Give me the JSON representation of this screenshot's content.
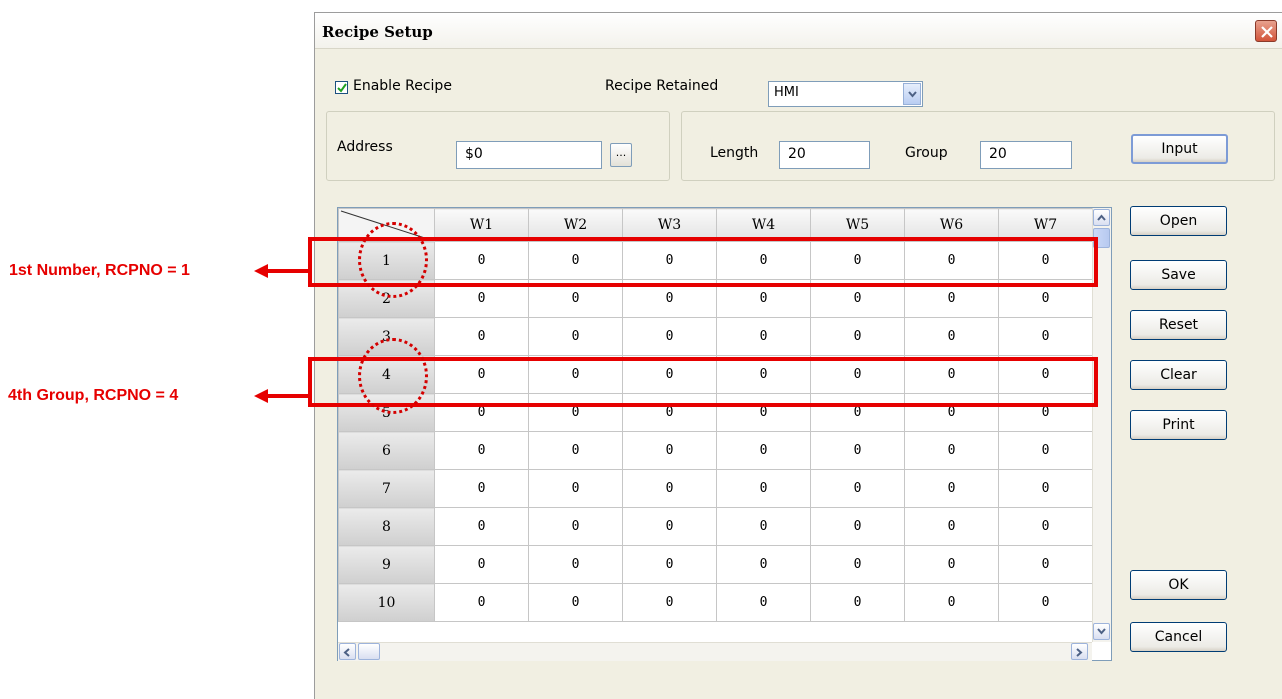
{
  "dialog": {
    "title": "Recipe Setup",
    "enable_recipe_label": "Enable Recipe",
    "enable_recipe_checked": true,
    "recipe_retained_label": "Recipe Retained",
    "recipe_retained_value": "HMI",
    "address_label": "Address",
    "address_value": "$0",
    "browse_label": "...",
    "length_label": "Length",
    "length_value": "20",
    "group_label": "Group",
    "group_value": "20",
    "input_button": "Input"
  },
  "side_buttons": [
    "Open",
    "Save",
    "Reset",
    "Clear",
    "Print"
  ],
  "ok_button": "OK",
  "cancel_button": "Cancel",
  "grid": {
    "columns": [
      "W1",
      "W2",
      "W3",
      "W4",
      "W5",
      "W6",
      "W7"
    ],
    "rows": [
      {
        "label": "1",
        "cells": [
          "0",
          "0",
          "0",
          "0",
          "0",
          "0",
          "0"
        ]
      },
      {
        "label": "2",
        "cells": [
          "0",
          "0",
          "0",
          "0",
          "0",
          "0",
          "0"
        ]
      },
      {
        "label": "3",
        "cells": [
          "0",
          "0",
          "0",
          "0",
          "0",
          "0",
          "0"
        ]
      },
      {
        "label": "4",
        "cells": [
          "0",
          "0",
          "0",
          "0",
          "0",
          "0",
          "0"
        ]
      },
      {
        "label": "5",
        "cells": [
          "0",
          "0",
          "0",
          "0",
          "0",
          "0",
          "0"
        ]
      },
      {
        "label": "6",
        "cells": [
          "0",
          "0",
          "0",
          "0",
          "0",
          "0",
          "0"
        ]
      },
      {
        "label": "7",
        "cells": [
          "0",
          "0",
          "0",
          "0",
          "0",
          "0",
          "0"
        ]
      },
      {
        "label": "8",
        "cells": [
          "0",
          "0",
          "0",
          "0",
          "0",
          "0",
          "0"
        ]
      },
      {
        "label": "9",
        "cells": [
          "0",
          "0",
          "0",
          "0",
          "0",
          "0",
          "0"
        ]
      },
      {
        "label": "10",
        "cells": [
          "0",
          "0",
          "0",
          "0",
          "0",
          "0",
          "0"
        ]
      }
    ]
  },
  "annotations": {
    "first": "1st Number, RCPNO = 1",
    "fourth": "4th Group, RCPNO = 4",
    "color": "#e60000"
  }
}
